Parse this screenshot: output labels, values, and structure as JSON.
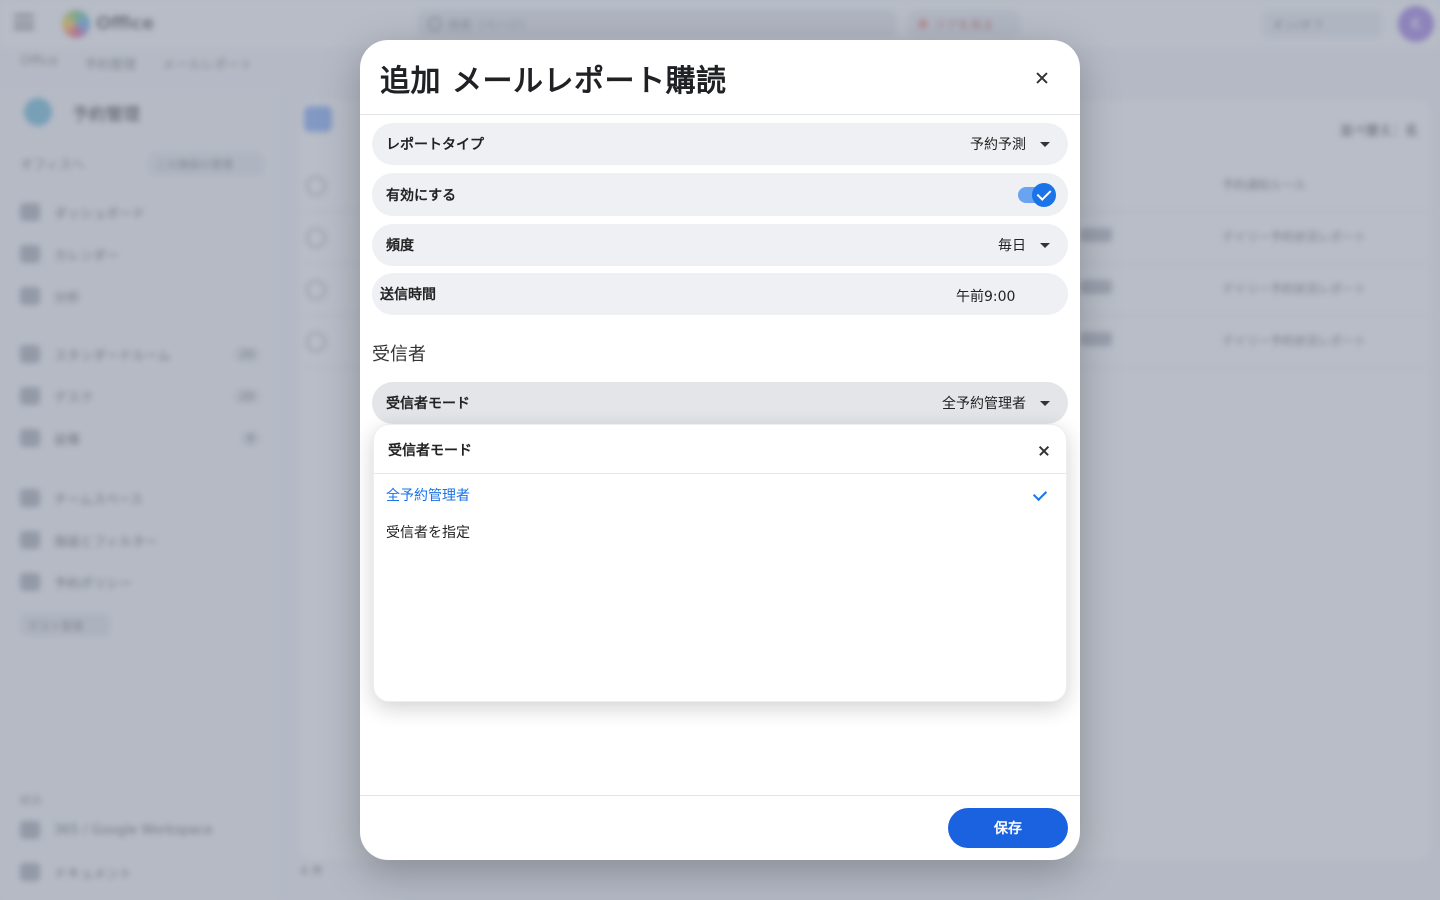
{
  "background": {
    "app_name": "Office",
    "search_placeholder": "検索（ページ）",
    "tour_label": "ツアを見る",
    "top_right_label": "オン/オフ",
    "avatar_initial": "K",
    "breadcrumbs": [
      "Office",
      "予約管理",
      "メールレポート"
    ],
    "sidebar": {
      "title": "予約管理",
      "back_label": "オフィスへ",
      "manage_label": "この施設の管理",
      "items": [
        {
          "label": "ダッシュボード",
          "badge": ""
        },
        {
          "label": "カレンダー",
          "badge": ""
        },
        {
          "label": "分析",
          "badge": ""
        },
        {
          "label": "スタンダードルーム",
          "badge": "20"
        },
        {
          "label": "デスク",
          "badge": "20"
        },
        {
          "label": "設備",
          "badge": "8"
        },
        {
          "label": "チームスペース",
          "badge": ""
        },
        {
          "label": "施設とフィルター",
          "badge": ""
        },
        {
          "label": "予約ポリシー",
          "badge": ""
        }
      ],
      "chip_label": "ゲスト管理",
      "footer_label": "統合",
      "footer_items": [
        "365 / Google Workspace",
        "ドキュメント"
      ]
    },
    "list": {
      "right_header": "並べ替え：名",
      "rows": [
        {
          "cell_b": "予約通知ルール"
        },
        {
          "cell_b": "デイリー予約状況レポート"
        },
        {
          "cell_b": "デイリー予約状況レポート"
        },
        {
          "cell_b": "デイリー予約状況レポート"
        }
      ],
      "pager_text": "4 件"
    }
  },
  "modal": {
    "title": "追加 メールレポート購読",
    "fields": {
      "report_type": {
        "label": "レポートタイプ",
        "value": "予約予測"
      },
      "enabled": {
        "label": "有効にする",
        "value": true
      },
      "frequency": {
        "label": "頻度",
        "value": "毎日"
      },
      "send_time": {
        "label": "送信時間",
        "value": "午前9:00"
      }
    },
    "recipients_section_title": "受信者",
    "recipient_mode": {
      "label": "受信者モード",
      "value": "全予約管理者"
    },
    "dropdown": {
      "title": "受信者モード",
      "options": [
        {
          "label": "全予約管理者",
          "selected": true
        },
        {
          "label": "受信者を指定",
          "selected": false
        }
      ]
    },
    "save_label": "保存"
  },
  "colors": {
    "accent": "#1a73e8",
    "save_button": "#1a62e0",
    "overlay": "rgba(95,105,125,0.38)"
  }
}
